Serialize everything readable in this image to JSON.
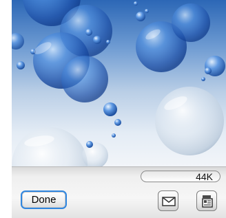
{
  "toolbar": {
    "file_size": "44K",
    "done_label": "Done"
  },
  "icons": {
    "mail": "mail-icon",
    "details": "file-details-icon"
  },
  "colors": {
    "accent": "#2f86e0",
    "wallpaper_top": "#2c67b6",
    "wallpaper_bottom": "#f2f5f9"
  }
}
